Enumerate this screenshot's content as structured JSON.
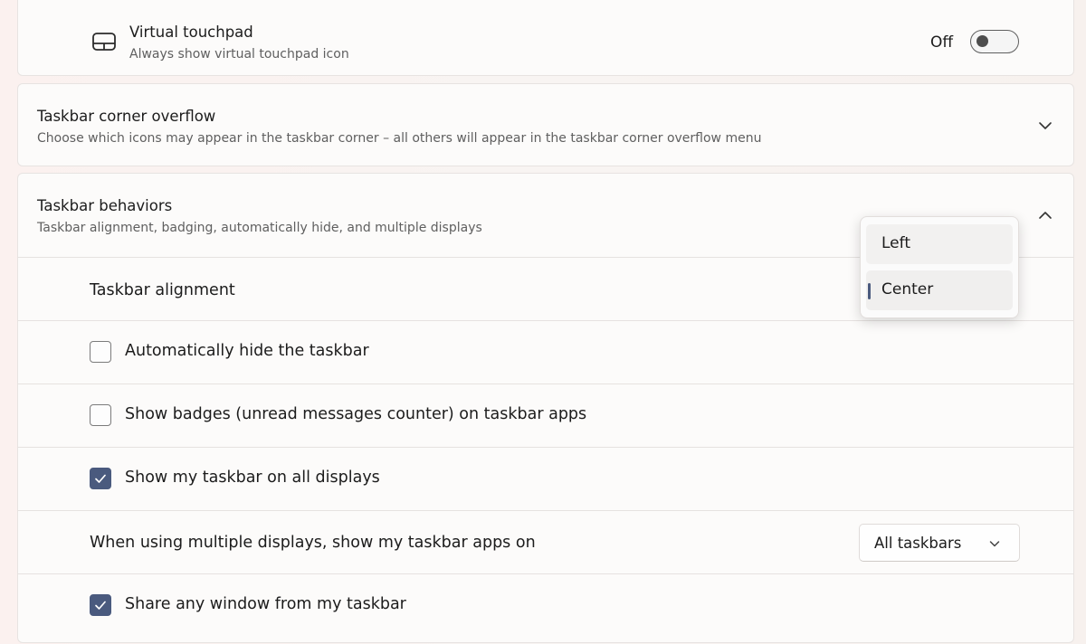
{
  "touchpad": {
    "title": "Virtual touchpad",
    "description": "Always show virtual touchpad icon",
    "toggle_label": "Off",
    "toggle_on": false,
    "icon": "touchpad-icon"
  },
  "corner_overflow": {
    "title": "Taskbar corner overflow",
    "description": "Choose which icons may appear in the taskbar corner – all others will appear in the taskbar corner overflow menu",
    "icon": "chevron-down-icon"
  },
  "behaviors": {
    "title": "Taskbar behaviors",
    "description": "Taskbar alignment, badging, automatically hide, and multiple displays",
    "icon": "chevron-up-icon",
    "alignment": {
      "label": "Taskbar alignment",
      "options": [
        "Left",
        "Center"
      ],
      "selected": "Center"
    },
    "auto_hide": {
      "label": "Automatically hide the taskbar",
      "checked": false
    },
    "badges": {
      "label": "Show badges (unread messages counter) on taskbar apps",
      "checked": false
    },
    "all_displays": {
      "label": "Show my taskbar on all displays",
      "checked": true
    },
    "multi_display_apps": {
      "label": "When using multiple displays, show my taskbar apps on",
      "value": "All taskbars"
    },
    "share_window": {
      "label": "Share any window from my taskbar",
      "checked": true
    }
  },
  "colors": {
    "accent": "#4a5a7e",
    "card_bg": "#fcfbfa",
    "border": "#e6e2e0"
  }
}
